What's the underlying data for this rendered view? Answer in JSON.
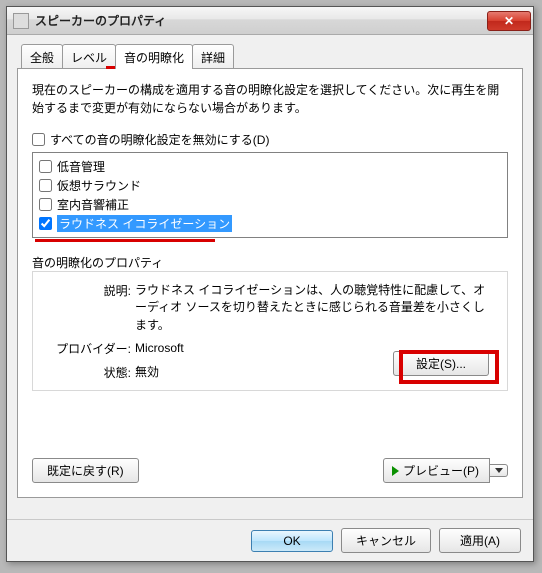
{
  "window": {
    "title": "スピーカーのプロパティ"
  },
  "tabs": {
    "general": "全般",
    "levels": "レベル",
    "enhancements": "音の明瞭化",
    "advanced": "詳細"
  },
  "panel": {
    "intro": "現在のスピーカーの構成を適用する音の明瞭化設定を選択してください。次に再生を開始するまで変更が有効にならない場合があります。",
    "disable_all": "すべての音の明瞭化設定を無効にする(D)",
    "items": {
      "bass": "低音管理",
      "virtual": "仮想サラウンド",
      "room": "室内音響補正",
      "loudness": "ラウドネス イコライゼーション"
    },
    "props_title": "音の明瞭化のプロパティ",
    "desc_label": "説明:",
    "desc_value": "ラウドネス イコライゼーションは、人の聴覚特性に配慮して、オーディオ ソースを切り替えたときに感じられる音量差を小さくします。",
    "provider_label": "プロバイダー:",
    "provider_value": "Microsoft",
    "state_label": "状態:",
    "state_value": "無効",
    "settings_btn": "設定(S)...",
    "restore_btn": "既定に戻す(R)",
    "preview_btn": "プレビュー(P)"
  },
  "footer": {
    "ok": "OK",
    "cancel": "キャンセル",
    "apply": "適用(A)"
  }
}
